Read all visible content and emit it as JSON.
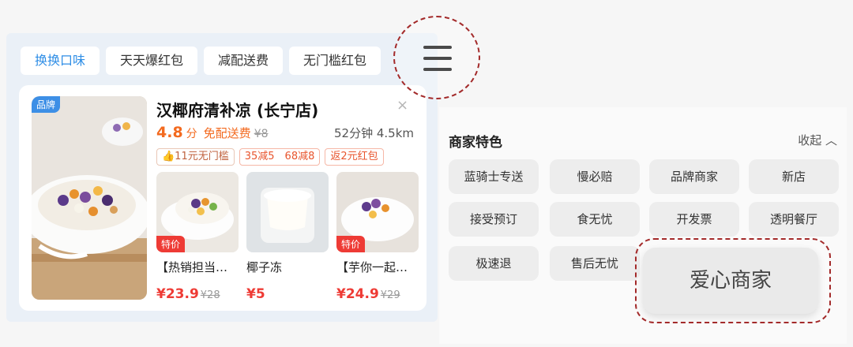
{
  "tabs": [
    "换换口味",
    "天天爆红包",
    "减配送费",
    "无门槛红包"
  ],
  "store": {
    "brand_tag": "品牌",
    "name": "汉椰府清补凉 (长宁店)",
    "rating": "4.8",
    "rating_unit": "分",
    "free_delivery": "免配送费",
    "orig_fee": "¥8",
    "meta": "52分钟 4.5km",
    "close": "×",
    "promos": [
      "👍11元无门槛",
      "35减5　68减8",
      "返2元红包"
    ],
    "items": [
      {
        "badge": "特价",
        "name": "【热销担当…",
        "price": "¥23.9",
        "was": "¥28"
      },
      {
        "badge": "",
        "name": "椰子冻",
        "price": "¥5",
        "was": ""
      },
      {
        "badge": "特价",
        "name": "【芋你一起…",
        "price": "¥24.9",
        "was": "¥29"
      }
    ]
  },
  "features": {
    "title": "商家特色",
    "collapse": "收起 ︿",
    "chips": [
      "蓝骑士专送",
      "慢必赔",
      "品牌商家",
      "新店",
      "接受预订",
      "食无忧",
      "开发票",
      "透明餐厅",
      "极速退",
      "售后无忧"
    ],
    "highlight": "爱心商家"
  },
  "icons": {
    "menu": "menu-icon"
  },
  "colors": {
    "accent_orange": "#f36a1f",
    "price_red": "#ee3b35",
    "tab_blue": "#2f8ee6",
    "annotation_red": "#a32a2a"
  }
}
